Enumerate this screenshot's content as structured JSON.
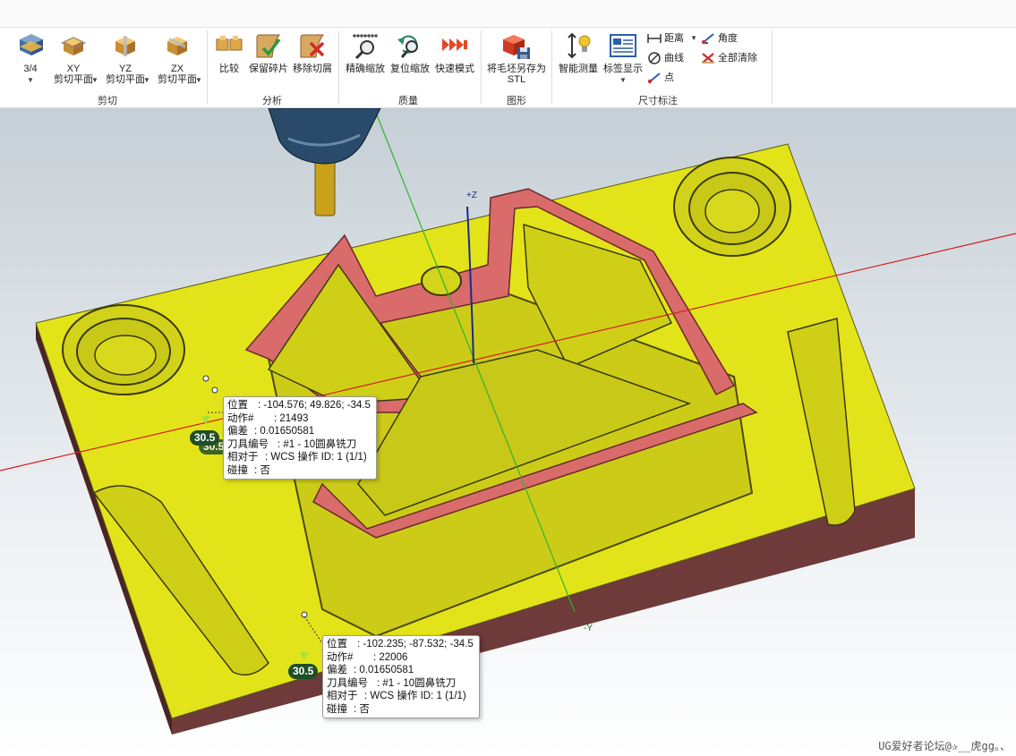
{
  "ribbon": {
    "buttons": {
      "view_34": "3/4",
      "xy_top": "XY",
      "xy_bottom": "剪切平面",
      "yz_top": "YZ",
      "yz_bottom": "剪切平面",
      "zx_top": "ZX",
      "zx_bottom": "剪切平面",
      "compare": "比较",
      "keep_chips": "保留碎片",
      "remove_cut": "移除切屑",
      "fine_zoom": "精确缩放",
      "reset_zoom": "复位缩放",
      "fast_mode": "快速模式",
      "save_stl_top": "将毛坯另存为",
      "save_stl_bottom": "STL",
      "smart_measure": "智能测量",
      "label_display": "标签显示",
      "distance": "距离",
      "angle": "角度",
      "curve": "曲线",
      "clear_all": "全部清除",
      "point": "点"
    },
    "groups": {
      "cut": "剪切",
      "analysis": "分析",
      "quality": "质量",
      "graphics": "图形",
      "dimension": "尺寸标注"
    }
  },
  "viewport": {
    "axis_z": "+Z",
    "axis_y": "-Y",
    "tooltip1": {
      "pos_label": "位置",
      "pos_value": ": -104.576;  49.826;  -34.5",
      "action_label": "动作#",
      "action_value": ": 21493",
      "tol_label": "偏差",
      "tol_value": ": 0.01650581",
      "tool_label": "刀具编号",
      "tool_value": ": #1 - 10圆鼻铣刀",
      "rel_label": "相对于",
      "rel_value": ": WCS 操作 ID: 1 (1/1)",
      "collision_label": "碰撞",
      "collision_value": ": 否"
    },
    "tooltip2": {
      "pos_label": "位置",
      "pos_value": ": -102.235;  -87.532;  -34.5",
      "action_label": "动作#",
      "action_value": ": 22006",
      "tol_label": "偏差",
      "tol_value": ": 0.01650581",
      "tool_label": "刀具编号",
      "tool_value": ": #1 - 10圆鼻铣刀",
      "rel_label": "相对于",
      "rel_value": ": WCS 操作 ID: 1 (1/1)",
      "collision_label": "碰撞",
      "collision_value": ": 否"
    },
    "badge1": "30.5",
    "badge1_ghost": "30.5",
    "badge2": "30.5",
    "watermark": "UG爱好者论坛@✰__虎gg。、"
  },
  "colors": {
    "stock_yellow": "#e3e31a",
    "stock_side": "#6e3a3a",
    "cut_red": "#d96b6b",
    "axis_red": "#d62020",
    "axis_green": "#2db52d",
    "badge_green": "#1f4f27"
  }
}
